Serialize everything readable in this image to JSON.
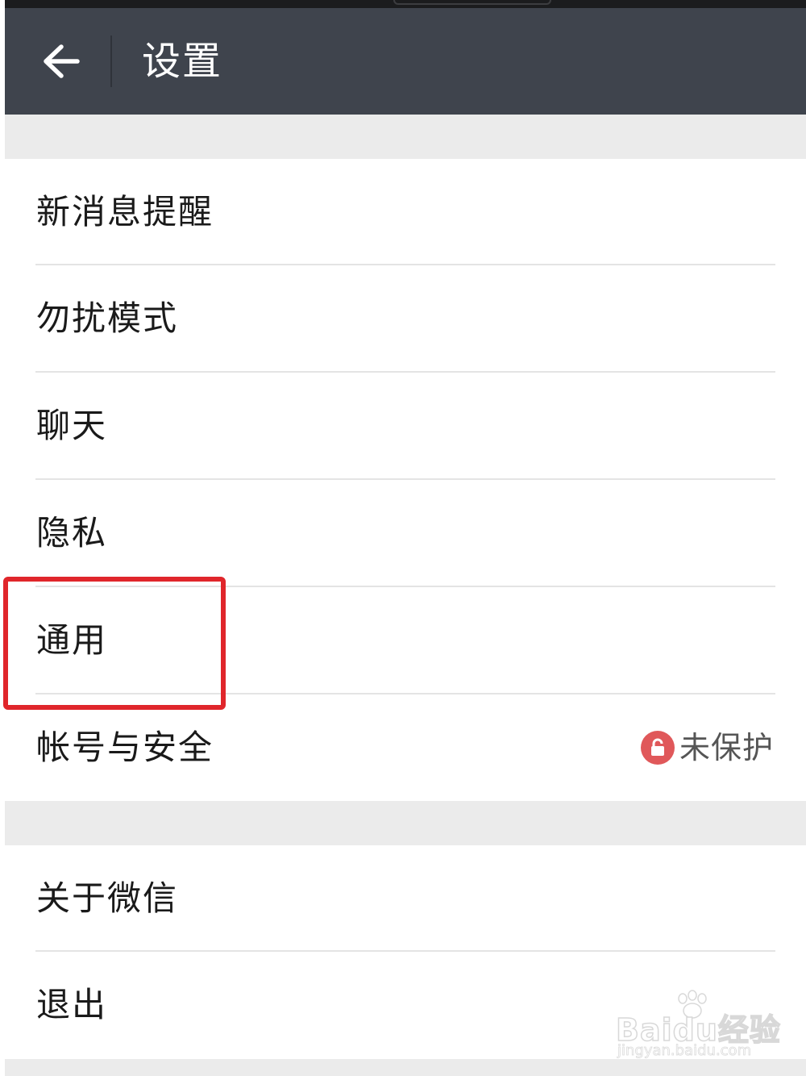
{
  "nav": {
    "title": "设置",
    "back_icon": "arrow-left-icon"
  },
  "sections": [
    {
      "items": [
        {
          "label": "新消息提醒"
        },
        {
          "label": "勿扰模式"
        },
        {
          "label": "聊天"
        },
        {
          "label": "隐私"
        },
        {
          "label": "通用",
          "highlighted": true
        },
        {
          "label": "帐号与安全",
          "status": "未保护",
          "status_icon": "unlock-icon"
        }
      ]
    },
    {
      "items": [
        {
          "label": "关于微信"
        },
        {
          "label": "退出"
        }
      ]
    }
  ],
  "watermark": {
    "logo": "Baidu经验",
    "url": "jingyan.baidu.com"
  },
  "colors": {
    "nav_bg": "#3f444d",
    "page_bg": "#ebebeb",
    "highlight": "#e0262b",
    "status_icon_bg": "#e0585a"
  }
}
